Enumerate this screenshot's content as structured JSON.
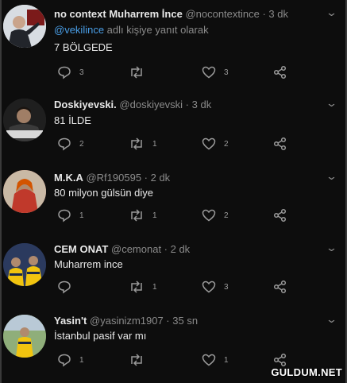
{
  "tweets": [
    {
      "name": "no context Muharrem İnce",
      "handle": "@nocontextince · 3 dk",
      "reply_mention": "@vekilince",
      "reply_suffix": " adlı kişiye yanıt olarak",
      "text": "7 BÖLGEDE",
      "reply_count": "3",
      "retweet_count": "",
      "like_count": "3"
    },
    {
      "name": "Doskiyevski.",
      "handle": "@doskiyevski · 3 dk",
      "text": "81 İLDE",
      "reply_count": "2",
      "retweet_count": "1",
      "like_count": "2"
    },
    {
      "name": "M.K.A",
      "handle": "@Rf190595 · 2 dk",
      "text": "80 milyon gülsün diye",
      "reply_count": "1",
      "retweet_count": "1",
      "like_count": "2"
    },
    {
      "name": "CEM ONAT",
      "handle": "@cemonat · 2 dk",
      "text": "Muharrem ince",
      "reply_count": "",
      "retweet_count": "1",
      "like_count": "3"
    },
    {
      "name": "Yasin't",
      "handle": "@yasinizm1907 · 35 sn",
      "text": "İstanbul pasif var mı",
      "reply_count": "1",
      "retweet_count": "",
      "like_count": "1"
    }
  ],
  "watermark": "GULDUM.NET",
  "colors": {
    "background": "#0d0d0d",
    "mention": "#4a9fe8",
    "muted": "#8a8a8a"
  }
}
